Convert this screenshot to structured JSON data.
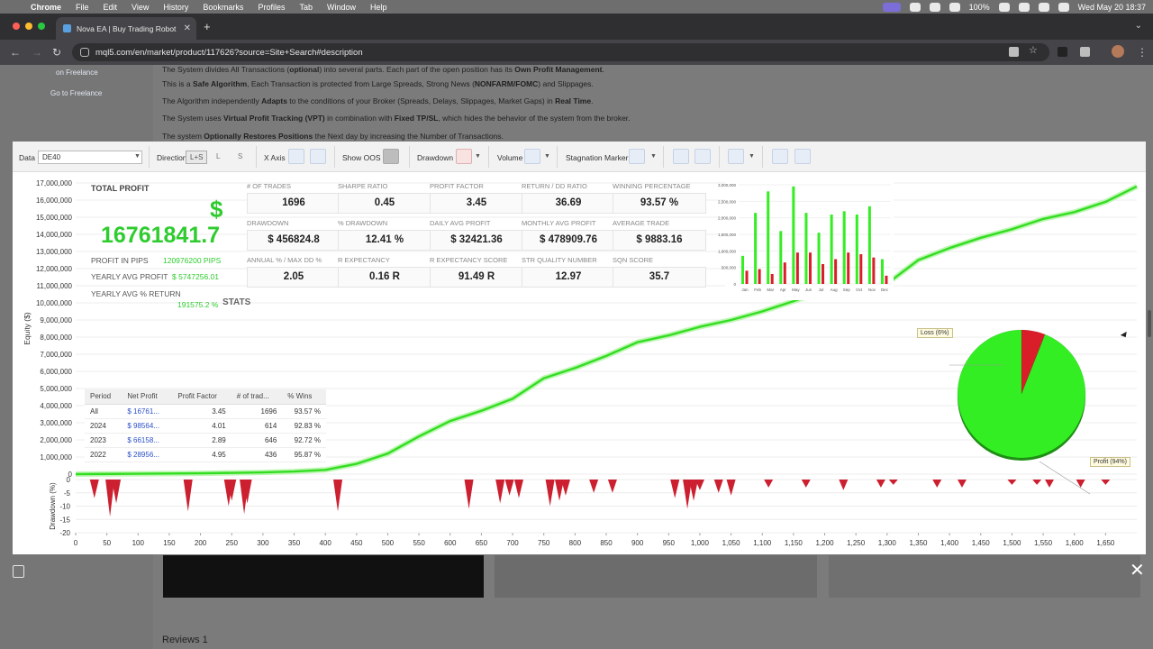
{
  "menubar": {
    "app": "Chrome",
    "items": [
      "File",
      "Edit",
      "View",
      "History",
      "Bookmarks",
      "Profiles",
      "Tab",
      "Window",
      "Help"
    ],
    "battery": "100%",
    "clock": "Wed May 20  18:37"
  },
  "browser": {
    "tab_title": "Nova EA | Buy Trading Robot",
    "url": "mql5.com/en/market/product/117626?source=Site+Search#description"
  },
  "page": {
    "sidebar_link1": "on Freelance",
    "sidebar_link2": "Go to Freelance",
    "lines": [
      {
        "pre": "The System divides All Transactions (",
        "b1": "optional",
        "mid": ") into several parts. Each part of the open position has its ",
        "b2": "Own Profit Management",
        "post": "."
      },
      {
        "pre": "This is a ",
        "b1": "Safe Algorithm",
        "mid": ", Each Transaction is protected from Large Spreads, Strong News (",
        "b2": "NONFARM/FOMC",
        "post": ") and Slippages."
      },
      {
        "pre": "The Algorithm independently ",
        "b1": "Adapts",
        "mid": " to the conditions of your Broker (Spreads, Delays, Slippages, Market Gaps) in ",
        "b2": "Real Time",
        "post": "."
      },
      {
        "pre": "The System uses ",
        "b1": "Virtual Profit Tracking (VPT)",
        "mid": " in combination with ",
        "b2": "Fixed TP/SL",
        "post": ", which hides the behavior of the system from the broker."
      },
      {
        "pre": "The system ",
        "b1": "Optionally Restores Positions",
        "mid": " the Next day by increasing the Number of Transactions.",
        "b2": "",
        "post": ""
      }
    ],
    "reviews": "Reviews 1"
  },
  "controls": {
    "data_label": "Data",
    "data_value": "DE40",
    "direction_label": "Direction",
    "direction_options": [
      "L+S",
      "L",
      "S"
    ],
    "xaxis_label": "X Axis",
    "show_oos_label": "Show OOS",
    "drawdown_label": "Drawdown",
    "volume_label": "Volume",
    "stagnation_label": "Stagnation Marker"
  },
  "stats": {
    "total_profit_label": "TOTAL PROFIT",
    "currency": "$",
    "total_profit_value": "16761841.7",
    "profit_in_pips_label": "PROFIT IN PIPS",
    "profit_in_pips_value": "120976200 PIPS",
    "yearly_avg_profit_label": "YEARLY AVG PROFIT",
    "yearly_avg_profit_value": "$ 5747256.01",
    "yearly_avg_return_label": "YEARLY AVG % RETURN",
    "yearly_avg_return_value": "191575.2 %",
    "stats_word": "STATS",
    "metrics": [
      {
        "label": "# OF TRADES",
        "value": "1696"
      },
      {
        "label": "SHARPE RATIO",
        "value": "0.45"
      },
      {
        "label": "PROFIT FACTOR",
        "value": "3.45"
      },
      {
        "label": "RETURN / DD RATIO",
        "value": "36.69"
      },
      {
        "label": "WINNING PERCENTAGE",
        "value": "93.57 %"
      },
      {
        "label": "DRAWDOWN",
        "value": "$ 456824.8"
      },
      {
        "label": "% DRAWDOWN",
        "value": "12.41 %"
      },
      {
        "label": "DAILY AVG PROFIT",
        "value": "$ 32421.36"
      },
      {
        "label": "MONTHLY AVG PROFIT",
        "value": "$ 478909.76"
      },
      {
        "label": "AVERAGE TRADE",
        "value": "$ 9883.16"
      },
      {
        "label": "ANNUAL % / MAX DD %",
        "value": "2.05"
      },
      {
        "label": "R EXPECTANCY",
        "value": "0.16 R"
      },
      {
        "label": "R EXPECTANCY SCORE",
        "value": "91.49 R"
      },
      {
        "label": "STR QUALITY NUMBER",
        "value": "12.97"
      },
      {
        "label": "SQN SCORE",
        "value": "35.7"
      }
    ]
  },
  "period_table": {
    "headers": [
      "Period",
      "Net Profit",
      "Profit Factor",
      "# of trad...",
      "% Wins"
    ],
    "rows": [
      [
        "All",
        "$ 16761...",
        "3.45",
        "1696",
        "93.57 %"
      ],
      [
        "2024",
        "$ 98564...",
        "4.01",
        "614",
        "92.83 %"
      ],
      [
        "2023",
        "$ 66158...",
        "2.89",
        "646",
        "92.72 %"
      ],
      [
        "2022",
        "$ 28956...",
        "4.95",
        "436",
        "95.87 %"
      ]
    ]
  },
  "colors": {
    "equity": "#33dd22",
    "equity_glow": "#aef5a0",
    "drawdown": "#cc1f2f",
    "profit": "#33ee22",
    "loss": "#d91e2a",
    "grid": "#ececec"
  },
  "chart_data": [
    {
      "type": "line",
      "title": "",
      "ylabel": "Equity ($)",
      "xlim": [
        0,
        1700
      ],
      "ylim": [
        0,
        17000000
      ],
      "yticks": [
        "17,000,000",
        "16,000,000",
        "15,000,000",
        "14,000,000",
        "13,000,000",
        "12,000,000",
        "11,000,000",
        "10,000,000",
        "9,000,000",
        "8,000,000",
        "7,000,000",
        "6,000,000",
        "5,000,000",
        "4,000,000",
        "3,000,000",
        "2,000,000",
        "1,000,000",
        "0"
      ],
      "xticks": [
        "0",
        "50",
        "100",
        "150",
        "200",
        "250",
        "300",
        "350",
        "400",
        "450",
        "500",
        "550",
        "600",
        "650",
        "700",
        "750",
        "800",
        "850",
        "900",
        "950",
        "1,000",
        "1,050",
        "1,100",
        "1,150",
        "1,200",
        "1,250",
        "1,300",
        "1,350",
        "1,400",
        "1,450",
        "1,500",
        "1,550",
        "1,600",
        "1,650"
      ],
      "series": [
        {
          "x": [
            0,
            100,
            200,
            300,
            350,
            400,
            450,
            500,
            550,
            600,
            650,
            700,
            750,
            800,
            850,
            900,
            950,
            1000,
            1050,
            1100,
            1150,
            1200,
            1250,
            1300,
            1310,
            1350,
            1400,
            1450,
            1500,
            1550,
            1600,
            1650,
            1700
          ],
          "y": [
            0,
            20000,
            50000,
            100000,
            150000,
            250000,
            600000,
            1200000,
            2200000,
            3100000,
            3700000,
            4400000,
            5600000,
            6200000,
            6900000,
            7700000,
            8100000,
            8600000,
            9000000,
            9500000,
            10100000,
            10700000,
            11500000,
            11800000,
            11400000,
            12500000,
            13200000,
            13800000,
            14300000,
            14900000,
            15300000,
            15900000,
            16800000
          ]
        }
      ]
    },
    {
      "type": "bar",
      "title": "",
      "ylabel": "Drawdown (%)",
      "xlim": [
        0,
        1700
      ],
      "ylim": [
        -20,
        0
      ],
      "yticks": [
        "0",
        "-5",
        "-10",
        "-15",
        "-20"
      ],
      "x": [
        30,
        55,
        65,
        180,
        245,
        250,
        270,
        275,
        420,
        630,
        680,
        695,
        710,
        760,
        775,
        785,
        830,
        860,
        960,
        980,
        990,
        1000,
        1030,
        1050,
        1110,
        1170,
        1230,
        1290,
        1310,
        1380,
        1420,
        1500,
        1540,
        1560,
        1610,
        1650
      ],
      "values": [
        -7,
        -14,
        -9,
        -12,
        -10,
        -8,
        -13,
        -9,
        -12,
        -11,
        -9,
        -6,
        -7,
        -10,
        -8,
        -6,
        -5,
        -5,
        -7,
        -11,
        -8,
        -4,
        -5,
        -6,
        -3,
        -3,
        -4,
        -3,
        -2,
        -3,
        -3,
        -2,
        -2,
        -3,
        -3,
        -2
      ]
    },
    {
      "type": "bar",
      "title": "",
      "categories": [
        "Jan",
        "Feb",
        "Mar",
        "Apr",
        "May",
        "Jun",
        "Jul",
        "Aug",
        "Sep",
        "Oct",
        "Nov",
        "Dec"
      ],
      "yticks": [
        "3,000,000",
        "2,500,000",
        "2,000,000",
        "1,500,000",
        "1,000,000",
        "500,000",
        "0"
      ],
      "ylim": [
        0,
        3000000
      ],
      "series": [
        {
          "values": [
            850000,
            2150000,
            2800000,
            1600000,
            2950000,
            2150000,
            1550000,
            2100000,
            2200000,
            2100000,
            2350000,
            750000
          ]
        },
        {
          "values": [
            400000,
            450000,
            300000,
            650000,
            950000,
            950000,
            600000,
            750000,
            950000,
            900000,
            800000,
            250000
          ]
        }
      ]
    },
    {
      "type": "pie",
      "title": "",
      "labels": [
        "Loss (6%)",
        "Profit (94%)"
      ],
      "values": [
        6,
        94
      ]
    }
  ]
}
